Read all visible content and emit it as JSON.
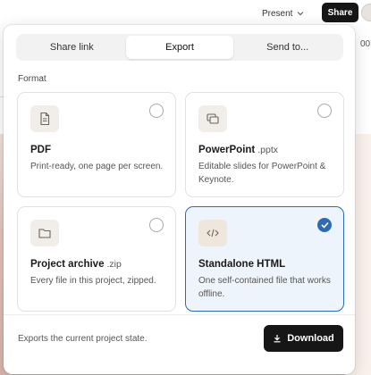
{
  "topbar": {
    "present_label": "Present",
    "share_label": "Share"
  },
  "background": {
    "right_edge_text": "00"
  },
  "tabs": [
    {
      "label": "Share link",
      "active": false
    },
    {
      "label": "Export",
      "active": true
    },
    {
      "label": "Send to...",
      "active": false
    }
  ],
  "format_label": "Format",
  "options": [
    {
      "title": "PDF",
      "ext": "",
      "desc": "Print-ready, one page per screen.",
      "icon": "document-icon",
      "selected": false
    },
    {
      "title": "PowerPoint",
      "ext": ".pptx",
      "desc": "Editable slides for PowerPoint & Keynote.",
      "icon": "slides-icon",
      "selected": false
    },
    {
      "title": "Project archive",
      "ext": ".zip",
      "desc": "Every file in this project, zipped.",
      "icon": "folder-icon",
      "selected": false
    },
    {
      "title": "Standalone HTML",
      "ext": "",
      "desc": "One self-contained file that works offline.",
      "icon": "code-icon",
      "selected": true
    }
  ],
  "footer": {
    "note": "Exports the current project state.",
    "download_label": "Download"
  },
  "colors": {
    "accent": "#2f6ab4",
    "selected_card_bg": "#eef4fb",
    "primary_button": "#161616"
  }
}
